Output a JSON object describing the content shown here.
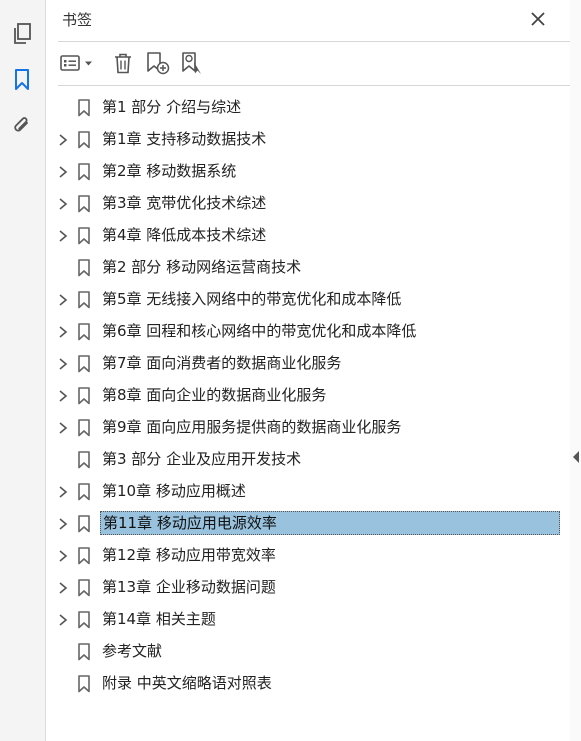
{
  "panel": {
    "title": "书签"
  },
  "colors": {
    "accent": "#1473e6",
    "selected_bg": "#99c2de",
    "icon": "#555555"
  },
  "rail": {
    "icons": [
      "pages-icon",
      "bookmark-icon",
      "attachment-icon"
    ],
    "active": "bookmark-icon"
  },
  "toolbar": {
    "icons": [
      "options-menu-icon",
      "delete-bookmark-icon",
      "add-bookmark-icon",
      "find-bookmark-icon"
    ]
  },
  "bookmarks": [
    {
      "label": "第1 部分 介绍与综述",
      "expandable": false
    },
    {
      "label": "第1章 支持移动数据技术",
      "expandable": true
    },
    {
      "label": "第2章 移动数据系统",
      "expandable": true
    },
    {
      "label": "第3章 宽带优化技术综述",
      "expandable": true
    },
    {
      "label": "第4章 降低成本技术综述",
      "expandable": true
    },
    {
      "label": "第2 部分 移动网络运营商技术",
      "expandable": false
    },
    {
      "label": "第5章 无线接入网络中的带宽优化和成本降低",
      "expandable": true
    },
    {
      "label": "第6章 回程和核心网络中的带宽优化和成本降低",
      "expandable": true
    },
    {
      "label": "第7章 面向消费者的数据商业化服务",
      "expandable": true
    },
    {
      "label": "第8章 面向企业的数据商业化服务",
      "expandable": true
    },
    {
      "label": "第9章 面向应用服务提供商的数据商业化服务",
      "expandable": true
    },
    {
      "label": "第3 部分 企业及应用开发技术",
      "expandable": false
    },
    {
      "label": "第10章 移动应用概述",
      "expandable": true
    },
    {
      "label": "第11章 移动应用电源效率",
      "expandable": true,
      "selected": true
    },
    {
      "label": "第12章 移动应用带宽效率",
      "expandable": true
    },
    {
      "label": "第13章 企业移动数据问题",
      "expandable": true
    },
    {
      "label": "第14章 相关主题",
      "expandable": true
    },
    {
      "label": "参考文献",
      "expandable": false
    },
    {
      "label": "附录 中英文缩略语对照表",
      "expandable": false
    }
  ]
}
